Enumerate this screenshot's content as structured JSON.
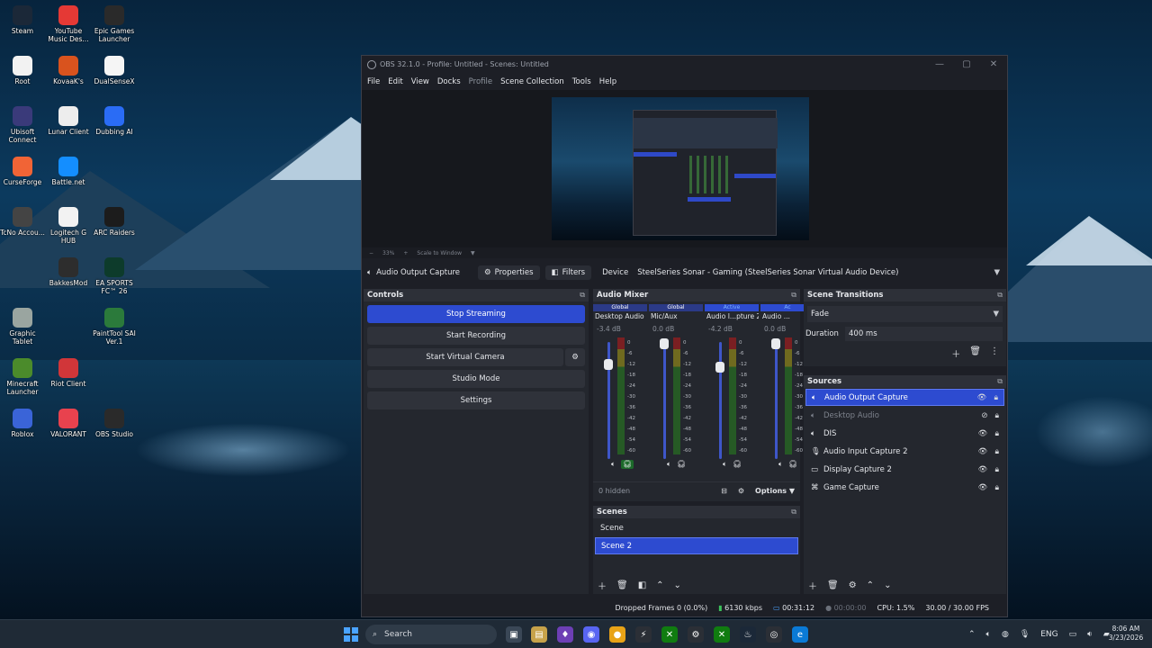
{
  "desktop": {
    "icons": [
      {
        "label": "Steam",
        "icon": "steam-icon",
        "color": "#1b2838"
      },
      {
        "label": "YouTube Music Des...",
        "icon": "youtube-music-icon",
        "color": "#e53935"
      },
      {
        "label": "Epic Games Launcher",
        "icon": "epic-games-icon",
        "color": "#2a2a2a"
      },
      {
        "label": "Root",
        "icon": "root-icon",
        "color": "#f2f2f2"
      },
      {
        "label": "KovaaK's",
        "icon": "kovaaks-icon",
        "color": "#d9531e"
      },
      {
        "label": "DualSenseX",
        "icon": "dualsensex-icon",
        "color": "#f5f5f5"
      },
      {
        "label": "Ubisoft Connect",
        "icon": "ubisoft-icon",
        "color": "#3a3a7a"
      },
      {
        "label": "Lunar Client",
        "icon": "lunar-client-icon",
        "color": "#ededed"
      },
      {
        "label": "Dubbing AI",
        "icon": "dubbing-ai-icon",
        "color": "#2a6cf5"
      },
      {
        "label": "CurseForge",
        "icon": "curseforge-icon",
        "color": "#f16436"
      },
      {
        "label": "Battle.net",
        "icon": "battlenet-icon",
        "color": "#148eff"
      },
      {
        "label": "",
        "icon": "",
        "color": ""
      },
      {
        "label": "TcNo Accou...",
        "icon": "tcno-icon",
        "color": "#444"
      },
      {
        "label": "Logitech G HUB",
        "icon": "logitech-icon",
        "color": "#f2f2f2"
      },
      {
        "label": "ARC Raiders",
        "icon": "arc-raiders-icon",
        "color": "#1c1c1c"
      },
      {
        "label": "",
        "icon": "",
        "color": ""
      },
      {
        "label": "BakkesMod",
        "icon": "bakkesmod-icon",
        "color": "#2d2d2d"
      },
      {
        "label": "EA SPORTS FC™ 26",
        "icon": "ea-fc-icon",
        "color": "#0d3b2b"
      },
      {
        "label": "Graphic Tablet",
        "icon": "graphic-tablet-icon",
        "color": "#9aa5a0"
      },
      {
        "label": "",
        "icon": "",
        "color": ""
      },
      {
        "label": "PaintTool SAI Ver.1",
        "icon": "painttool-icon",
        "color": "#2b7a3b"
      },
      {
        "label": "Minecraft Launcher",
        "icon": "minecraft-icon",
        "color": "#4b8b2b"
      },
      {
        "label": "Riot Client",
        "icon": "riot-client-icon",
        "color": "#d13639"
      },
      {
        "label": "",
        "icon": "",
        "color": ""
      },
      {
        "label": "Roblox",
        "icon": "roblox-icon",
        "color": "#3a64d8"
      },
      {
        "label": "VALORANT",
        "icon": "valorant-icon",
        "color": "#e8424e"
      },
      {
        "label": "OBS Studio",
        "icon": "obs-icon",
        "color": "#2a2a2a"
      }
    ]
  },
  "window": {
    "title": "OBS 32.1.0 - Profile: Untitled - Scenes: Untitled",
    "menu": [
      "File",
      "Edit",
      "View",
      "Docks",
      "Profile",
      "Scene Collection",
      "Tools",
      "Help"
    ],
    "zoom": "33%",
    "zoom_mode": "Scale to Window"
  },
  "source_bar": {
    "name": "Audio Output Capture",
    "properties": "Properties",
    "filters": "Filters",
    "device_label": "Device",
    "device_value": "SteelSeries Sonar - Gaming (SteelSeries Sonar Virtual Audio Device)"
  },
  "controls": {
    "title": "Controls",
    "stop_streaming": "Stop Streaming",
    "start_recording": "Start Recording",
    "start_virtual_camera": "Start Virtual Camera",
    "studio_mode": "Studio Mode",
    "settings": "Settings"
  },
  "mixer": {
    "title": "Audio Mixer",
    "channels": [
      {
        "tag": "Global",
        "name": "Desktop Audio",
        "db": "-3.4 dB",
        "level": 0.82
      },
      {
        "tag": "Global",
        "name": "Mic/Aux",
        "db": "0.0 dB",
        "level": 1.0
      },
      {
        "tag": "Active",
        "name": "Audio I...pture 2",
        "db": "-4.2 dB",
        "level": 0.8
      },
      {
        "tag": "Ac",
        "name": "Audio ...",
        "db": "0.0 dB",
        "level": 1.0
      }
    ],
    "scale": [
      "0",
      "-6",
      "-12",
      "-18",
      "-24",
      "-30",
      "-36",
      "-42",
      "-48",
      "-54",
      "-60"
    ],
    "hidden": "0 hidden",
    "options": "Options"
  },
  "scenes": {
    "title": "Scenes",
    "items": [
      "Scene",
      "Scene 2"
    ],
    "selected": 1
  },
  "transitions": {
    "title": "Scene Transitions",
    "type": "Fade",
    "duration_label": "Duration",
    "duration_value": "400 ms"
  },
  "sources": {
    "title": "Sources",
    "items": [
      {
        "name": "Audio Output Capture",
        "icon": "speaker-icon",
        "selected": true,
        "hidden": false
      },
      {
        "name": "Desktop Audio",
        "icon": "speaker-icon",
        "selected": false,
        "hidden": true
      },
      {
        "name": "DIS",
        "icon": "speaker-icon",
        "selected": false,
        "hidden": false
      },
      {
        "name": "Audio Input Capture 2",
        "icon": "microphone-icon",
        "selected": false,
        "hidden": false
      },
      {
        "name": "Display Capture 2",
        "icon": "monitor-icon",
        "selected": false,
        "hidden": false
      },
      {
        "name": "Game Capture",
        "icon": "gamepad-icon",
        "selected": false,
        "hidden": false
      }
    ]
  },
  "status": {
    "dropped": "Dropped Frames 0 (0.0%)",
    "bitrate": "6130 kbps",
    "stream_time": "00:31:12",
    "rec_time": "00:00:00",
    "cpu": "CPU: 1.5%",
    "fps": "30.00 / 30.00 FPS"
  },
  "taskbar": {
    "search": "Search",
    "lang": "ENG",
    "time": "8:06 AM",
    "date": "3/23/2026"
  }
}
